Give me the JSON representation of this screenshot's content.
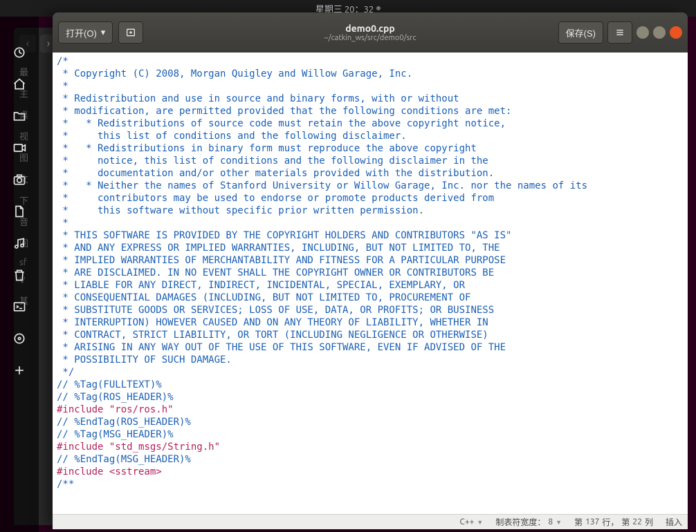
{
  "topbar": {
    "clock": "星期三 20：32"
  },
  "launcher": {
    "items": [
      {
        "name": "activities-icon"
      },
      {
        "name": "home-icon"
      },
      {
        "name": "files-icon"
      },
      {
        "name": "video-icon"
      },
      {
        "name": "camera-icon"
      },
      {
        "name": "document-icon"
      },
      {
        "name": "music-icon"
      },
      {
        "name": "trash-icon"
      },
      {
        "name": "terminal-icon"
      },
      {
        "name": "disc-icon"
      },
      {
        "name": "add-icon"
      }
    ]
  },
  "window": {
    "open_label": "打开(O)",
    "save_label": "保存(S)",
    "filename": "demo0.cpp",
    "filepath": "~/catkin_ws/src/demo0/src"
  },
  "underneath": {
    "items": [
      "最",
      "主",
      "桌",
      "视",
      "图",
      "文",
      "下",
      "音",
      "回",
      "sf",
      "V",
      "其"
    ]
  },
  "code_lines": [
    {
      "cls": "cm",
      "t": "/*"
    },
    {
      "cls": "cm",
      "t": " * Copyright (C) 2008, Morgan Quigley and Willow Garage, Inc."
    },
    {
      "cls": "cm",
      "t": " *"
    },
    {
      "cls": "cm",
      "t": " * Redistribution and use in source and binary forms, with or without"
    },
    {
      "cls": "cm",
      "t": " * modification, are permitted provided that the following conditions are met:"
    },
    {
      "cls": "cm",
      "t": " *   * Redistributions of source code must retain the above copyright notice,"
    },
    {
      "cls": "cm",
      "t": " *     this list of conditions and the following disclaimer."
    },
    {
      "cls": "cm",
      "t": " *   * Redistributions in binary form must reproduce the above copyright"
    },
    {
      "cls": "cm",
      "t": " *     notice, this list of conditions and the following disclaimer in the"
    },
    {
      "cls": "cm",
      "t": " *     documentation and/or other materials provided with the distribution."
    },
    {
      "cls": "cm",
      "t": " *   * Neither the names of Stanford University or Willow Garage, Inc. nor the names of its"
    },
    {
      "cls": "cm",
      "t": " *     contributors may be used to endorse or promote products derived from"
    },
    {
      "cls": "cm",
      "t": " *     this software without specific prior written permission."
    },
    {
      "cls": "cm",
      "t": " *"
    },
    {
      "cls": "cm",
      "t": " * THIS SOFTWARE IS PROVIDED BY THE COPYRIGHT HOLDERS AND CONTRIBUTORS \"AS IS\""
    },
    {
      "cls": "cm",
      "t": " * AND ANY EXPRESS OR IMPLIED WARRANTIES, INCLUDING, BUT NOT LIMITED TO, THE"
    },
    {
      "cls": "cm",
      "t": " * IMPLIED WARRANTIES OF MERCHANTABILITY AND FITNESS FOR A PARTICULAR PURPOSE"
    },
    {
      "cls": "cm",
      "t": " * ARE DISCLAIMED. IN NO EVENT SHALL THE COPYRIGHT OWNER OR CONTRIBUTORS BE"
    },
    {
      "cls": "cm",
      "t": " * LIABLE FOR ANY DIRECT, INDIRECT, INCIDENTAL, SPECIAL, EXEMPLARY, OR"
    },
    {
      "cls": "cm",
      "t": " * CONSEQUENTIAL DAMAGES (INCLUDING, BUT NOT LIMITED TO, PROCUREMENT OF"
    },
    {
      "cls": "cm",
      "t": " * SUBSTITUTE GOODS OR SERVICES; LOSS OF USE, DATA, OR PROFITS; OR BUSINESS"
    },
    {
      "cls": "cm",
      "t": " * INTERRUPTION) HOWEVER CAUSED AND ON ANY THEORY OF LIABILITY, WHETHER IN"
    },
    {
      "cls": "cm",
      "t": " * CONTRACT, STRICT LIABILITY, OR TORT (INCLUDING NEGLIGENCE OR OTHERWISE)"
    },
    {
      "cls": "cm",
      "t": " * ARISING IN ANY WAY OUT OF THE USE OF THIS SOFTWARE, EVEN IF ADVISED OF THE"
    },
    {
      "cls": "cm",
      "t": " * POSSIBILITY OF SUCH DAMAGE."
    },
    {
      "cls": "cm",
      "t": " */"
    },
    {
      "cls": "cm",
      "t": "// %Tag(FULLTEXT)%"
    },
    {
      "cls": "cm",
      "t": "// %Tag(ROS_HEADER)%"
    },
    {
      "cls": "pp",
      "t": "#include \"ros/ros.h\""
    },
    {
      "cls": "cm",
      "t": "// %EndTag(ROS_HEADER)%"
    },
    {
      "cls": "cm",
      "t": "// %Tag(MSG_HEADER)%"
    },
    {
      "cls": "pp",
      "t": "#include \"std_msgs/String.h\""
    },
    {
      "cls": "cm",
      "t": "// %EndTag(MSG_HEADER)%"
    },
    {
      "cls": "",
      "t": ""
    },
    {
      "cls": "pp",
      "t": "#include <sstream>"
    },
    {
      "cls": "",
      "t": ""
    },
    {
      "cls": "cm",
      "t": "/**"
    }
  ],
  "status": {
    "lang": "C++",
    "tab_label": "制表符宽度：",
    "tab_width": "8",
    "line_label": "第",
    "line_num": "137",
    "line_suffix": "行，",
    "col_label": "第",
    "col_num": "22",
    "col_suffix": "列",
    "insert_mode": "插入"
  },
  "watermark": ""
}
